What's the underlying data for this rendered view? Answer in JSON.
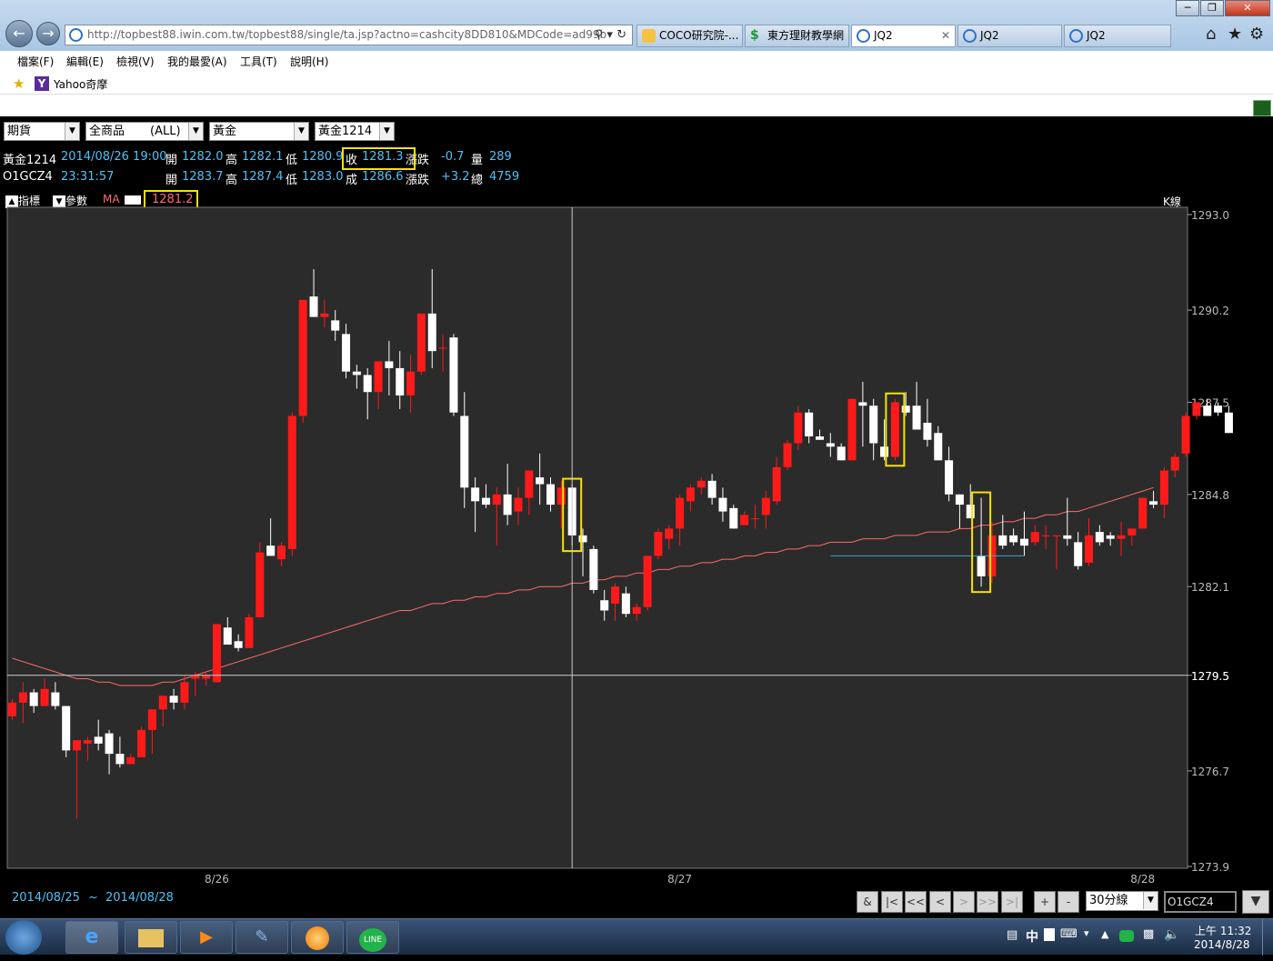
{
  "browser": {
    "url": "http://topbest88.iwin.com.tw/topbest88/single/ta.jsp?actno=cashcity8DD810&MDCode=ad99b",
    "tabs": [
      {
        "label": "COCO研究院-..."
      },
      {
        "label": "東方理財教學網"
      },
      {
        "label": "JQ2"
      },
      {
        "label": "JQ2"
      },
      {
        "label": "JQ2"
      }
    ],
    "menu": [
      "檔案(F)",
      "編輯(E)",
      "檢視(V)",
      "我的最愛(A)",
      "工具(T)",
      "說明(H)"
    ],
    "favorite": "Yahoo奇摩"
  },
  "selectors": {
    "market": "期貨",
    "category": "全商品",
    "category_scope": "(ALL)",
    "commodity": "黃金",
    "contract": "黃金1214"
  },
  "quote1": {
    "symbol": "黃金1214",
    "datetime": "2014/08/26 19:00",
    "open_label": "開",
    "open": "1282.0",
    "high_label": "高",
    "high": "1282.1",
    "low_label": "低",
    "low": "1280.9",
    "close_label": "收",
    "close": "1281.3",
    "change_label": "漲跌",
    "change": "-0.7",
    "vol_label": "量",
    "vol": "289"
  },
  "quote2": {
    "symbol": "O1GCZ4",
    "time": "23:31:57",
    "open_label": "開",
    "open": "1283.7",
    "high_label": "高",
    "high": "1287.4",
    "low_label": "低",
    "low": "1283.0",
    "last_label": "成",
    "last": "1286.6",
    "change_label": "漲跌",
    "change": "+3.2",
    "total_label": "總",
    "total": "4759"
  },
  "indicator_bar": {
    "indicator": "指標",
    "params": "參數",
    "ma_label": "MA",
    "ma_value": "1281.2",
    "kline_label": "K線"
  },
  "crosshair_value": "1279.5",
  "date_range": {
    "from": "2014/08/25",
    "sep": "~",
    "to": "2014/08/28"
  },
  "nav": {
    "amp": "&",
    "first": "|<",
    "prev_page": "<<",
    "prev": "<",
    "next": ">",
    "next_page": ">>",
    "last": ">|",
    "zoom_in": "+",
    "zoom_out": "-",
    "period": "30分線",
    "symbol_input": "O1GCZ4"
  },
  "clock": {
    "time": "上午 11:32",
    "date": "2014/8/28"
  },
  "ime": "中",
  "chart_data": {
    "type": "candlestick",
    "title": "",
    "y_ticks": [
      1293.0,
      1290.2,
      1287.5,
      1284.8,
      1282.1,
      1279.5,
      1276.7,
      1273.9
    ],
    "y_tick_labels": [
      "1293.0",
      "1290.2",
      "1287.5",
      "1284.8",
      "1282.1",
      "1279.5",
      "1276.7",
      "1273.9"
    ],
    "ylim": [
      1273.9,
      1293.0
    ],
    "x_tick_labels": [
      {
        "label": "8/26",
        "index": 19
      },
      {
        "label": "8/27",
        "index": 62
      },
      {
        "label": "8/28",
        "index": 105
      }
    ],
    "crosshair_index": 52,
    "colors": {
      "up": "#ff1a1a",
      "down": "#ffffff",
      "ma": "#ff6b6b",
      "support": "#3aa0d8",
      "highlight": "#f5e400",
      "bg": "#2b2b2b"
    },
    "highlighted_bars": [
      52,
      82,
      90
    ],
    "support_line": {
      "from_index": 76,
      "to_index": 94,
      "value": 1283.0
    },
    "ohlc": [
      [
        1278.3,
        1278.8,
        1278.2,
        1278.7
      ],
      [
        1278.7,
        1279.3,
        1278.1,
        1279.0
      ],
      [
        1279.0,
        1279.1,
        1278.4,
        1278.6
      ],
      [
        1278.6,
        1279.4,
        1278.6,
        1279.1
      ],
      [
        1279.0,
        1279.3,
        1278.5,
        1278.6
      ],
      [
        1278.6,
        1278.6,
        1277.1,
        1277.3
      ],
      [
        1277.3,
        1277.5,
        1275.3,
        1277.6
      ],
      [
        1277.5,
        1277.7,
        1277.0,
        1277.6
      ],
      [
        1277.7,
        1278.2,
        1277.3,
        1277.5
      ],
      [
        1277.8,
        1277.9,
        1276.6,
        1277.2
      ],
      [
        1277.2,
        1277.7,
        1276.8,
        1276.9
      ],
      [
        1276.9,
        1277.2,
        1276.9,
        1277.1
      ],
      [
        1277.1,
        1278.0,
        1277.1,
        1277.9
      ],
      [
        1277.9,
        1278.4,
        1277.2,
        1278.5
      ],
      [
        1278.5,
        1278.8,
        1278.0,
        1278.9
      ],
      [
        1278.9,
        1279.1,
        1278.5,
        1278.7
      ],
      [
        1278.7,
        1279.5,
        1278.5,
        1279.3
      ],
      [
        1279.4,
        1279.6,
        1278.9,
        1279.5
      ],
      [
        1279.4,
        1279.6,
        1279.2,
        1279.5
      ],
      [
        1279.3,
        1281.0,
        1279.3,
        1281.0
      ],
      [
        1280.9,
        1281.2,
        1280.4,
        1280.4
      ],
      [
        1280.5,
        1280.7,
        1280.2,
        1280.3
      ],
      [
        1280.3,
        1281.3,
        1280.3,
        1281.2
      ],
      [
        1281.2,
        1283.4,
        1281.2,
        1283.1
      ],
      [
        1283.3,
        1284.1,
        1283.0,
        1283.0
      ],
      [
        1282.9,
        1283.4,
        1282.7,
        1283.3
      ],
      [
        1283.2,
        1287.2,
        1283.0,
        1287.1
      ],
      [
        1287.1,
        1290.5,
        1286.9,
        1290.5
      ],
      [
        1290.6,
        1291.4,
        1290.1,
        1290.0
      ],
      [
        1290.0,
        1290.5,
        1289.7,
        1290.1
      ],
      [
        1289.9,
        1290.2,
        1289.3,
        1289.6
      ],
      [
        1289.5,
        1289.8,
        1288.2,
        1288.4
      ],
      [
        1288.4,
        1288.6,
        1287.9,
        1288.3
      ],
      [
        1288.3,
        1288.5,
        1287.0,
        1287.8
      ],
      [
        1287.8,
        1288.6,
        1287.3,
        1288.7
      ],
      [
        1288.7,
        1289.3,
        1287.7,
        1288.5
      ],
      [
        1288.5,
        1289.0,
        1287.3,
        1287.7
      ],
      [
        1287.7,
        1288.9,
        1287.2,
        1288.4
      ],
      [
        1288.4,
        1290.1,
        1288.3,
        1290.1
      ],
      [
        1290.1,
        1291.4,
        1288.5,
        1289.0
      ],
      [
        1289.1,
        1289.5,
        1288.4,
        1289.1
      ],
      [
        1289.4,
        1289.5,
        1287.1,
        1287.2
      ],
      [
        1287.1,
        1287.8,
        1284.4,
        1285.0
      ],
      [
        1285.0,
        1285.3,
        1283.7,
        1284.6
      ],
      [
        1284.7,
        1285.1,
        1284.4,
        1284.5
      ],
      [
        1284.5,
        1285.0,
        1283.3,
        1284.8
      ],
      [
        1284.8,
        1285.7,
        1283.9,
        1284.2
      ],
      [
        1284.3,
        1285.0,
        1283.9,
        1284.7
      ],
      [
        1284.7,
        1285.5,
        1284.2,
        1285.5
      ],
      [
        1285.3,
        1286.0,
        1284.5,
        1285.1
      ],
      [
        1285.1,
        1285.3,
        1284.3,
        1284.5
      ],
      [
        1284.5,
        1285.2,
        1283.8,
        1285.0
      ],
      [
        1285.0,
        1285.1,
        1283.3,
        1283.6
      ],
      [
        1283.6,
        1283.8,
        1282.4,
        1283.4
      ],
      [
        1283.2,
        1283.3,
        1281.9,
        1282.0
      ],
      [
        1281.7,
        1282.0,
        1281.1,
        1281.4
      ],
      [
        1281.6,
        1282.2,
        1281.1,
        1282.1
      ],
      [
        1281.9,
        1282.1,
        1281.2,
        1281.3
      ],
      [
        1281.3,
        1281.6,
        1281.1,
        1281.5
      ],
      [
        1281.5,
        1283.0,
        1281.4,
        1283.0
      ],
      [
        1283.0,
        1283.8,
        1282.9,
        1283.7
      ],
      [
        1283.5,
        1283.9,
        1283.2,
        1283.8
      ],
      [
        1283.8,
        1284.8,
        1283.3,
        1284.7
      ],
      [
        1284.6,
        1285.1,
        1284.3,
        1285.0
      ],
      [
        1285.0,
        1285.3,
        1284.8,
        1285.2
      ],
      [
        1285.2,
        1285.4,
        1284.5,
        1284.7
      ],
      [
        1284.7,
        1285.0,
        1284.0,
        1284.3
      ],
      [
        1284.4,
        1284.5,
        1283.8,
        1283.8
      ],
      [
        1283.9,
        1284.3,
        1283.9,
        1284.2
      ],
      [
        1284.1,
        1284.5,
        1283.8,
        1284.1
      ],
      [
        1284.2,
        1284.9,
        1283.8,
        1284.7
      ],
      [
        1284.6,
        1285.9,
        1284.5,
        1285.6
      ],
      [
        1285.6,
        1286.4,
        1285.5,
        1286.3
      ],
      [
        1286.3,
        1287.4,
        1286.1,
        1287.2
      ],
      [
        1287.2,
        1287.3,
        1286.3,
        1286.5
      ],
      [
        1286.5,
        1286.7,
        1286.4,
        1286.4
      ],
      [
        1286.3,
        1286.6,
        1285.9,
        1286.2
      ],
      [
        1286.2,
        1286.3,
        1285.8,
        1285.8
      ],
      [
        1285.8,
        1287.6,
        1285.8,
        1287.6
      ],
      [
        1287.5,
        1288.1,
        1286.2,
        1287.4
      ],
      [
        1287.4,
        1287.6,
        1285.8,
        1286.3
      ],
      [
        1286.2,
        1287.0,
        1285.8,
        1285.9
      ],
      [
        1285.9,
        1287.6,
        1285.8,
        1287.5
      ],
      [
        1287.4,
        1287.8,
        1287.1,
        1287.2
      ],
      [
        1287.4,
        1288.1,
        1286.7,
        1286.7
      ],
      [
        1286.9,
        1287.6,
        1286.2,
        1286.4
      ],
      [
        1286.6,
        1286.8,
        1285.8,
        1285.8
      ],
      [
        1285.8,
        1286.2,
        1284.6,
        1284.8
      ],
      [
        1284.8,
        1284.8,
        1283.8,
        1284.5
      ],
      [
        1284.5,
        1285.1,
        1284.2,
        1284.1
      ],
      [
        1283.0,
        1284.7,
        1282.1,
        1282.4
      ],
      [
        1282.4,
        1284.0,
        1282.2,
        1283.6
      ],
      [
        1283.6,
        1284.2,
        1283.2,
        1283.3
      ],
      [
        1283.6,
        1283.8,
        1283.3,
        1283.4
      ],
      [
        1283.5,
        1284.3,
        1283.0,
        1283.3
      ],
      [
        1283.4,
        1283.9,
        1283.3,
        1283.7
      ],
      [
        1283.6,
        1283.9,
        1283.2,
        1283.6
      ],
      [
        1283.6,
        1283.6,
        1282.6,
        1283.6
      ],
      [
        1283.6,
        1284.7,
        1283.3,
        1283.5
      ],
      [
        1283.4,
        1283.7,
        1282.6,
        1282.7
      ],
      [
        1282.8,
        1284.1,
        1282.7,
        1283.6
      ],
      [
        1283.7,
        1283.9,
        1283.3,
        1283.4
      ],
      [
        1283.6,
        1283.7,
        1283.3,
        1283.5
      ],
      [
        1283.5,
        1284.0,
        1283.0,
        1283.6
      ],
      [
        1283.6,
        1283.8,
        1283.3,
        1283.8
      ],
      [
        1283.8,
        1284.7,
        1283.8,
        1284.7
      ],
      [
        1284.6,
        1284.9,
        1284.4,
        1284.5
      ],
      [
        1284.5,
        1285.6,
        1284.1,
        1285.5
      ],
      [
        1285.5,
        1286.0,
        1285.3,
        1285.9
      ],
      [
        1286.0,
        1287.2,
        1285.9,
        1287.1
      ],
      [
        1287.1,
        1287.5,
        1287.0,
        1287.5
      ],
      [
        1287.4,
        1287.6,
        1287.1,
        1287.1
      ],
      [
        1287.4,
        1287.5,
        1287.1,
        1287.2
      ],
      [
        1287.2,
        1287.4,
        1286.6,
        1286.6
      ]
    ],
    "ma": [
      1280.0,
      1279.9,
      1279.8,
      1279.7,
      1279.6,
      1279.5,
      1279.4,
      1279.4,
      1279.3,
      1279.3,
      1279.2,
      1279.2,
      1279.2,
      1279.2,
      1279.3,
      1279.3,
      1279.4,
      1279.5,
      1279.6,
      1279.7,
      1279.8,
      1279.9,
      1280.0,
      1280.1,
      1280.2,
      1280.3,
      1280.4,
      1280.5,
      1280.6,
      1280.7,
      1280.8,
      1280.9,
      1281.0,
      1281.1,
      1281.2,
      1281.3,
      1281.4,
      1281.4,
      1281.5,
      1281.6,
      1281.6,
      1281.7,
      1281.7,
      1281.8,
      1281.8,
      1281.9,
      1281.9,
      1282.0,
      1282.0,
      1282.1,
      1282.1,
      1282.1,
      1282.2,
      1282.2,
      1282.3,
      1282.3,
      1282.4,
      1282.4,
      1282.5,
      1282.5,
      1282.6,
      1282.6,
      1282.7,
      1282.7,
      1282.8,
      1282.8,
      1282.9,
      1282.9,
      1283.0,
      1283.0,
      1283.1,
      1283.1,
      1283.2,
      1283.2,
      1283.3,
      1283.3,
      1283.4,
      1283.4,
      1283.4,
      1283.5,
      1283.5,
      1283.5,
      1283.6,
      1283.6,
      1283.6,
      1283.7,
      1283.7,
      1283.7,
      1283.8,
      1283.8,
      1283.9,
      1283.9,
      1284.0,
      1284.0,
      1284.1,
      1284.1,
      1284.2,
      1284.2,
      1284.3,
      1284.3,
      1284.4,
      1284.5,
      1284.6,
      1284.7,
      1284.8,
      1284.9,
      1285.0
    ]
  }
}
